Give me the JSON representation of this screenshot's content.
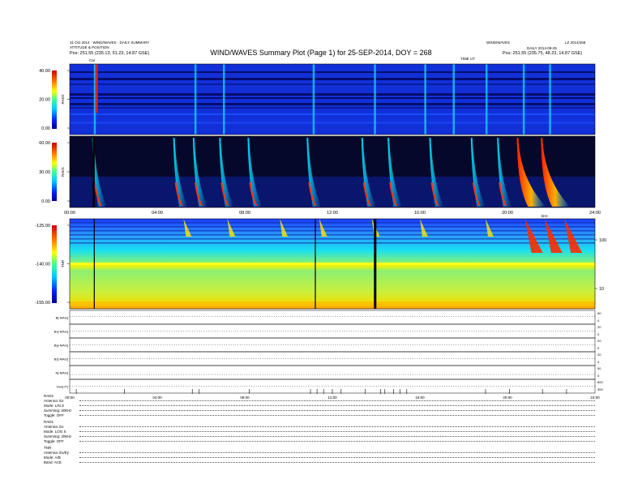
{
  "header": {
    "left_lines": [
      "31 Oct 2014 · WIND/WAVES · DAILY SUMMARY",
      "ATTITUDE & POSITION"
    ],
    "left_position": "Pos: 251.55 (235.13, 51.23, 14.87 GSE)",
    "right_lines": [
      "WIND/WAVES",
      "DAILY 2014-09-25"
    ],
    "right_position": "Pos: 251.55 (235.75, 48.23, 14.87 GSE)",
    "right_corner": "LZ 2014/268",
    "title": "WIND/WAVES Summary Plot (Page 1) for 25-SEP-2014, DOY = 268",
    "subhead_right": "TIME UT",
    "cal_marker": "Cal"
  },
  "colors": {
    "background": "#ffffff",
    "spectrogram_low": "#1a2ccf",
    "spectrogram_high": "#d4110a",
    "grid": "#000000"
  },
  "chart_data": [
    {
      "type": "heatmap",
      "name": "RAD2",
      "ylabel": "RAD2",
      "ytick_labels": [
        "40.00",
        "20.00",
        "0.00"
      ],
      "y_range": [
        0,
        40
      ],
      "x_range_hours": [
        0,
        24
      ],
      "colorbar": "jet",
      "burst_hours": [
        1.1,
        5.7,
        7.0,
        11.1,
        13.9,
        16.2,
        17.5,
        19.0,
        20.7,
        21.9
      ]
    },
    {
      "type": "heatmap",
      "name": "RAD1",
      "ylabel": "RAD1",
      "ytick_labels": [
        "60.00",
        "30.00",
        "0.00"
      ],
      "y_range": [
        0,
        60
      ],
      "x_range_hours": [
        0,
        24
      ],
      "colorbar": "jet",
      "burst_hours": [
        1.1,
        4.8,
        5.7,
        6.9,
        8.2,
        10.9,
        13.4,
        14.6,
        16.5,
        18.4,
        19.6,
        20.5,
        21.6
      ],
      "xtick_labels": [
        "00:00",
        "04:00",
        "08:00",
        "12:00",
        "16:00",
        "20:00",
        "24:00"
      ]
    },
    {
      "type": "heatmap",
      "name": "TNR",
      "ylabel": "TNR",
      "ytick_labels": [
        "-125.00",
        "-140.00",
        "-155.00"
      ],
      "y_range": [
        -155,
        -125
      ],
      "x_range_hours": [
        0,
        24
      ],
      "right_tick_labels": [
        "100",
        "10"
      ],
      "right_title": "kHz",
      "colorbar": "jet",
      "burst_hours": [
        5.2,
        7.2,
        9.6,
        11.4,
        13.8,
        16.0,
        19.0,
        20.8,
        21.7,
        22.6
      ]
    },
    {
      "type": "line",
      "name": "trend-panels",
      "rows": [
        {
          "label": "B[-MAG]",
          "right_tick_labels": [
            "0",
            "50"
          ],
          "level": 0.55
        },
        {
          "label": "Bx[-MAG]",
          "right_tick_labels": [
            "0",
            "20"
          ],
          "level": 0.5
        },
        {
          "label": "By[-MAG]",
          "right_tick_labels": [
            "0",
            "20"
          ],
          "level": 0.5
        },
        {
          "label": "Bz[-MAG]",
          "right_tick_labels": [
            "0",
            "20"
          ],
          "level": 0.5
        },
        {
          "label": "N[-MAG]",
          "right_tick_labels": [
            "0",
            "50"
          ],
          "level": 0.35
        },
        {
          "label": "Vsw[-IT]",
          "right_tick_labels": [
            "300",
            "600"
          ],
          "level": 0.5
        }
      ],
      "xtick_labels": [
        "00:00",
        "04:00",
        "08:00",
        "12:00",
        "16:00",
        "20:00",
        "24:00"
      ]
    }
  ],
  "settings": {
    "groups": [
      {
        "name": "RAD2",
        "lines": [
          "Antenna: Ex",
          "Mode: LIN  S",
          "Summing: 20kHz",
          "Toggle: OFF"
        ]
      },
      {
        "name": "RAD1",
        "lines": [
          "Antenna: Ex",
          "Mode: LOG  S",
          "Summing: 20kHz",
          "Toggle: OFF"
        ]
      },
      {
        "name": "TNR",
        "lines": [
          "Antenna: Ex/Ey",
          "Mode: A/B",
          "Band: ACE"
        ]
      }
    ]
  }
}
